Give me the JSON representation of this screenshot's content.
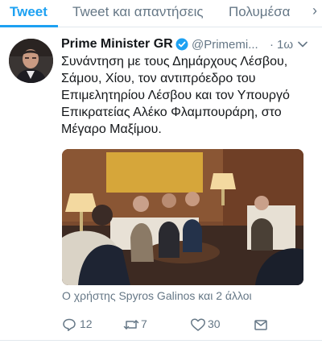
{
  "tabs": {
    "items": [
      "Tweet",
      "Tweet και απαντήσεις",
      "Πολυμέσα"
    ],
    "active": "Tweet",
    "more_label": "›"
  },
  "tweet": {
    "author_name": "Prime Minister GR",
    "handle": "@Primemi...",
    "separator": "·",
    "time": "1ω",
    "text": "Συνάντηση με τους Δημάρχους Λέσβου, Σάμου, Χίου, τον αντιπρόεδρο του Επιμελητηρίου Λέσβου και τον Υπουργό Επικρατείας Αλέκο Φλαμπουράρη, στο Μέγαρο Μαξίμου.",
    "tagged": "Ο χρήστης Spyros Galinos και 2 άλλοι"
  },
  "actions": {
    "replies": "12",
    "retweets": "7",
    "likes": "30"
  },
  "icons": [
    "verified-icon",
    "chevron-down-icon",
    "reply-icon",
    "retweet-icon",
    "like-icon",
    "share-icon"
  ],
  "colors": {
    "accent": "#1da1f2",
    "secondary_text": "#657786",
    "primary_text": "#14171a",
    "divider": "#e1e8ed"
  }
}
